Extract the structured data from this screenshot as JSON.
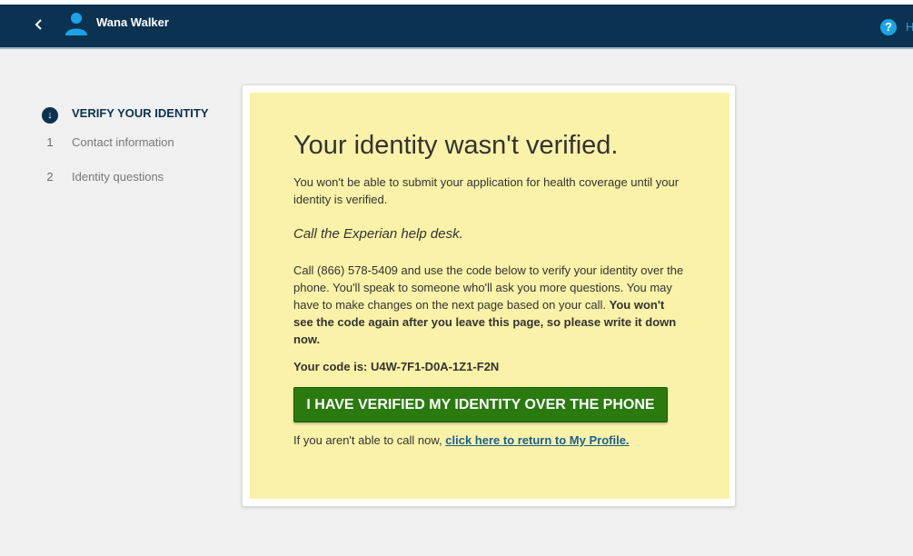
{
  "header": {
    "user_name": "Wana Walker",
    "help_label": "H",
    "back_icon": "chevron-left-icon",
    "avatar_icon": "person-icon",
    "help_icon": "question-circle-icon",
    "bar_color": "#0b3250",
    "help_color": "#1ca3e6"
  },
  "sidebar": {
    "steps": [
      {
        "marker": "↓",
        "label": "VERIFY YOUR IDENTITY",
        "active": true
      },
      {
        "number": "1",
        "label": "Contact information",
        "active": false
      },
      {
        "number": "2",
        "label": "Identity questions",
        "active": false
      }
    ]
  },
  "notice": {
    "title": "Your identity wasn't verified.",
    "intro": "You won't be able to submit your application for health coverage until your identity is verified.",
    "callout": "Call the Experian help desk.",
    "instructions": "Call (866) 578-5409 and use the code below to verify your identity over the phone. You'll speak to someone who'll ask you more questions. You may have to make changes on the next page based on your call.",
    "warning": "You won't see the code again after you leave this page, so please write it down now.",
    "code_label": "Your code is: U4W-7F1-D0A-1Z1-F2N",
    "button_label": "I HAVE VERIFIED MY IDENTITY OVER THE PHONE",
    "return_prefix": "If you aren't able to call now,",
    "return_link": "click here to return to My Profile.",
    "background_color": "#faf2a8",
    "button_color": "#2a7a10"
  }
}
